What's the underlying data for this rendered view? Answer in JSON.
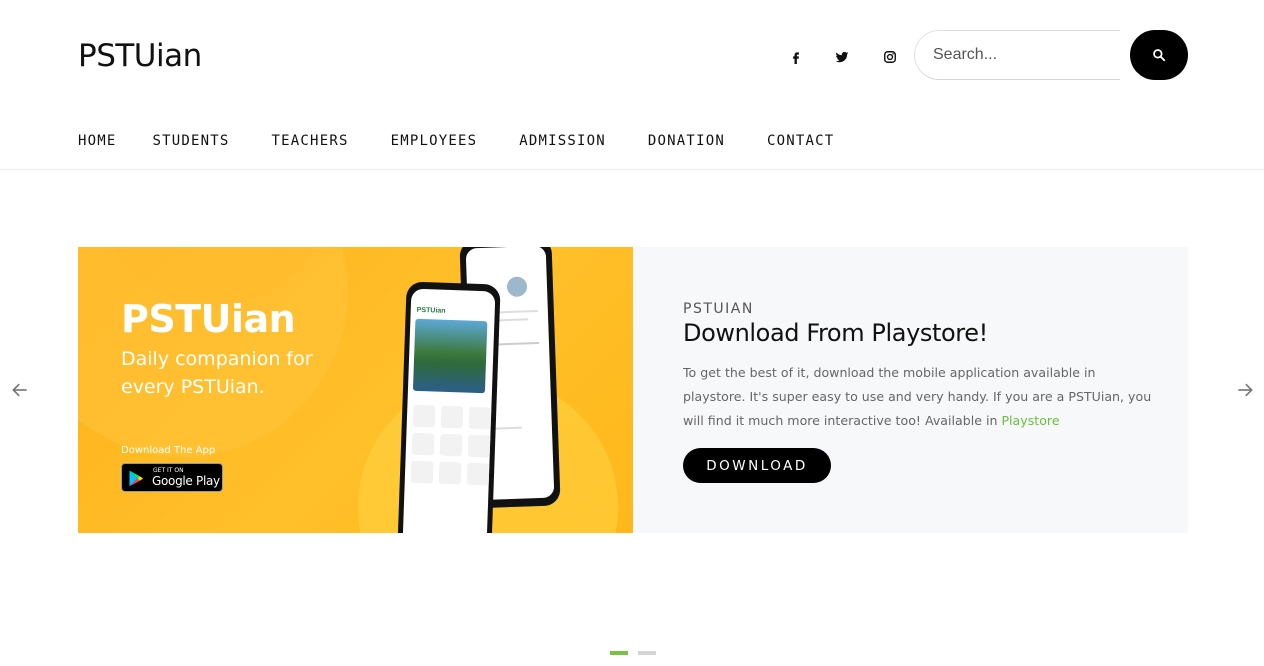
{
  "header": {
    "logo": "PSTUian",
    "social": [
      {
        "name": "facebook-icon"
      },
      {
        "name": "twitter-icon"
      },
      {
        "name": "instagram-icon"
      }
    ],
    "search": {
      "placeholder": "Search...",
      "value": ""
    },
    "search_button_icon": "search-icon"
  },
  "nav": {
    "items": [
      "HOME",
      "STUDENTS",
      "TEACHERS",
      "EMPLOYEES",
      "ADMISSION",
      "DONATION",
      "CONTACT"
    ]
  },
  "slide": {
    "banner": {
      "title": "PSTUian",
      "tagline": "Daily companion for every PSTUian.",
      "download_label": "Download The App",
      "badge_small": "GET IT ON",
      "badge_big": "Google Play",
      "phone_app_name": "PSTUian"
    },
    "eyebrow": "PSTUIAN",
    "title": "Download From Playstore!",
    "body": "To get the best of it, download the mobile application available in playstore. It's super easy to use and very handy. If you are a PSTUian, you will find it much more interactive too! Available in ",
    "link": "Playstore",
    "button": "DOWNLOAD"
  },
  "carousel": {
    "prev_icon": "arrow-left-icon",
    "next_icon": "arrow-right-icon",
    "active_index": 0,
    "count": 2
  },
  "colors": {
    "accent": "#7cc242",
    "banner": "#ffb81a",
    "button": "#000000"
  }
}
